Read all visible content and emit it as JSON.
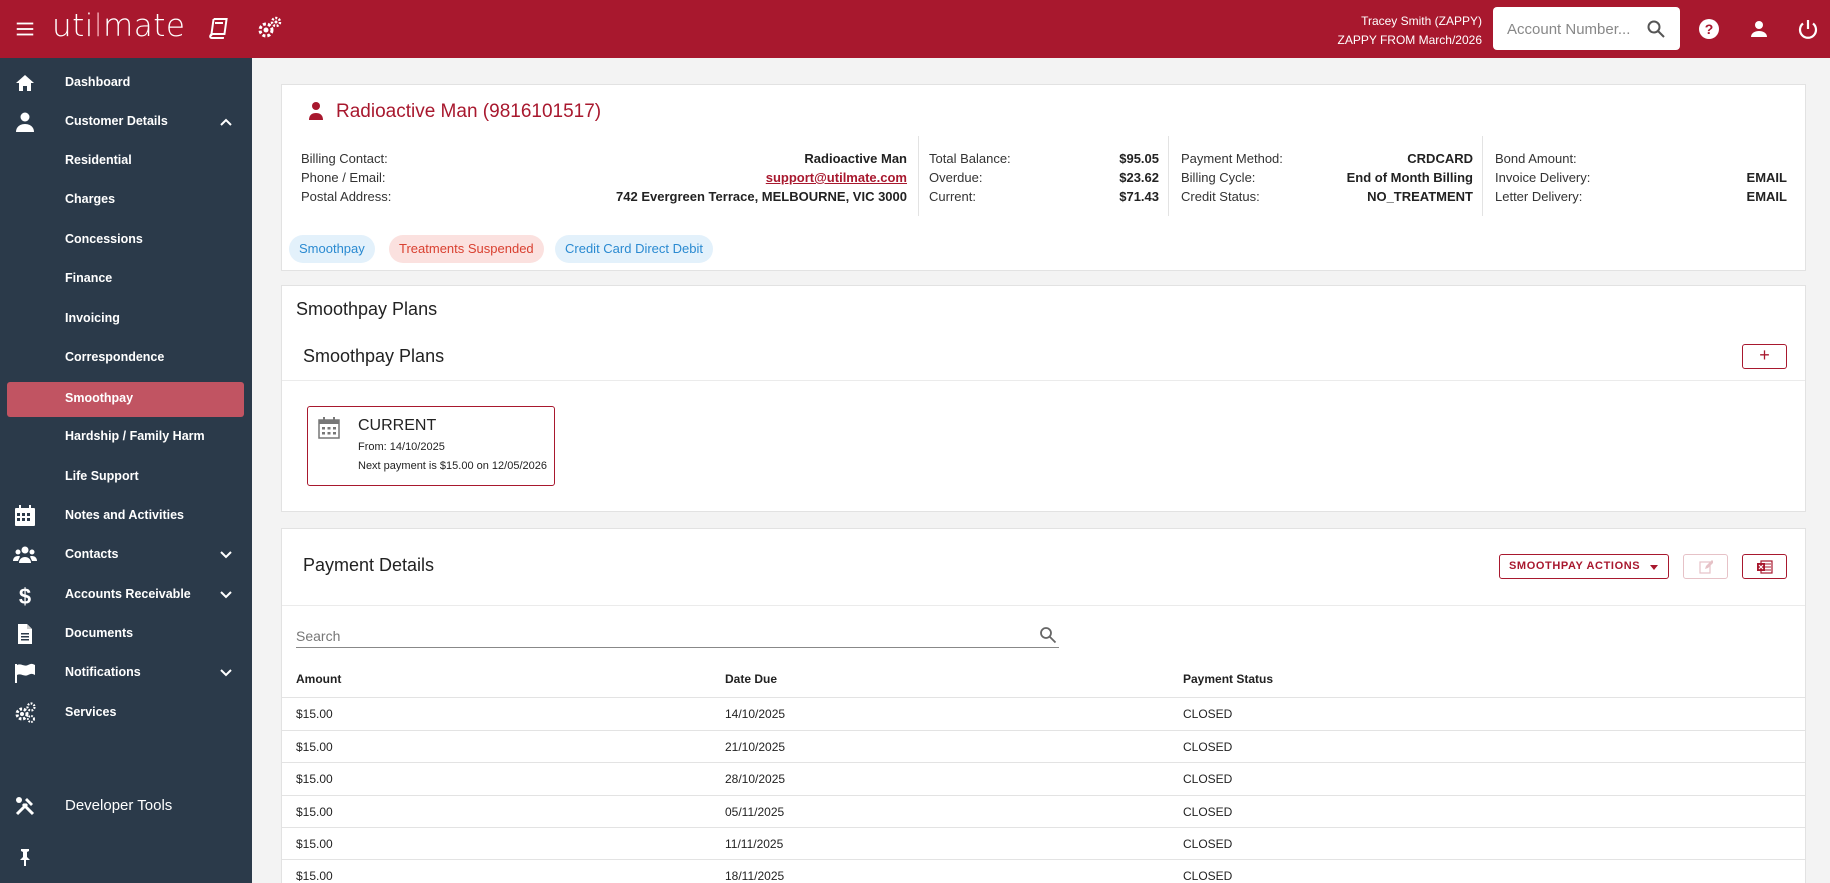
{
  "header": {
    "logo_prefix": "uti",
    "logo_accent": "l",
    "logo_suffix": "mate",
    "user_name": "Tracey Smith (ZAPPY)",
    "user_sub": "ZAPPY FROM March/2026",
    "search_placeholder": "Account Number..."
  },
  "sidebar": {
    "items": [
      {
        "label": "Dashboard"
      },
      {
        "label": "Customer Details"
      },
      {
        "label": "Residential"
      },
      {
        "label": "Charges"
      },
      {
        "label": "Concessions"
      },
      {
        "label": "Finance"
      },
      {
        "label": "Invoicing"
      },
      {
        "label": "Correspondence"
      },
      {
        "label": "Smoothpay"
      },
      {
        "label": "Hardship / Family Harm"
      },
      {
        "label": "Life Support"
      },
      {
        "label": "Notes and Activities"
      },
      {
        "label": "Contacts"
      },
      {
        "label": "Accounts Receivable"
      },
      {
        "label": "Documents"
      },
      {
        "label": "Notifications"
      },
      {
        "label": "Services"
      }
    ],
    "developer_tools": "Developer Tools"
  },
  "customer": {
    "name": "Radioactive Man (9816101517)",
    "billing_contact_label": "Billing Contact:",
    "billing_contact": "Radioactive Man",
    "phone_email_label": "Phone / Email:",
    "email": "support@utilmate.com",
    "postal_label": "Postal Address:",
    "postal": "742 Evergreen Terrace, MELBOURNE, VIC 3000",
    "total_balance_label": "Total Balance:",
    "total_balance": "$95.05",
    "overdue_label": "Overdue:",
    "overdue": "$23.62",
    "current_label": "Current:",
    "current": "$71.43",
    "payment_method_label": "Payment Method:",
    "payment_method": "CRDCARD",
    "billing_cycle_label": "Billing Cycle:",
    "billing_cycle": "End of Month Billing",
    "credit_status_label": "Credit Status:",
    "credit_status": "NO_TREATMENT",
    "bond_label": "Bond Amount:",
    "invoice_delivery_label": "Invoice Delivery:",
    "invoice_delivery": "EMAIL",
    "letter_delivery_label": "Letter Delivery:",
    "letter_delivery": "EMAIL",
    "chips": [
      "Smoothpay",
      "Treatments Suspended",
      "Credit Card Direct Debit"
    ]
  },
  "plans": {
    "page_title": "Smoothpay Plans",
    "section_title": "Smoothpay Plans",
    "add_label": "+",
    "plan": {
      "status": "CURRENT",
      "from": "From: 14/10/2025",
      "next": "Next payment is $15.00 on 12/05/2026"
    }
  },
  "payments": {
    "title": "Payment Details",
    "actions_label": "SMOOTHPAY ACTIONS",
    "search_placeholder": "Search",
    "columns": [
      "Amount",
      "Date Due",
      "Payment Status"
    ],
    "rows": [
      [
        "$15.00",
        "14/10/2025",
        "CLOSED"
      ],
      [
        "$15.00",
        "21/10/2025",
        "CLOSED"
      ],
      [
        "$15.00",
        "28/10/2025",
        "CLOSED"
      ],
      [
        "$15.00",
        "05/11/2025",
        "CLOSED"
      ],
      [
        "$15.00",
        "11/11/2025",
        "CLOSED"
      ],
      [
        "$15.00",
        "18/11/2025",
        "CLOSED"
      ]
    ]
  },
  "colors": {
    "brand": "#a8182e",
    "sidebar": "#2b3a4a",
    "active_item": "#c15462"
  }
}
